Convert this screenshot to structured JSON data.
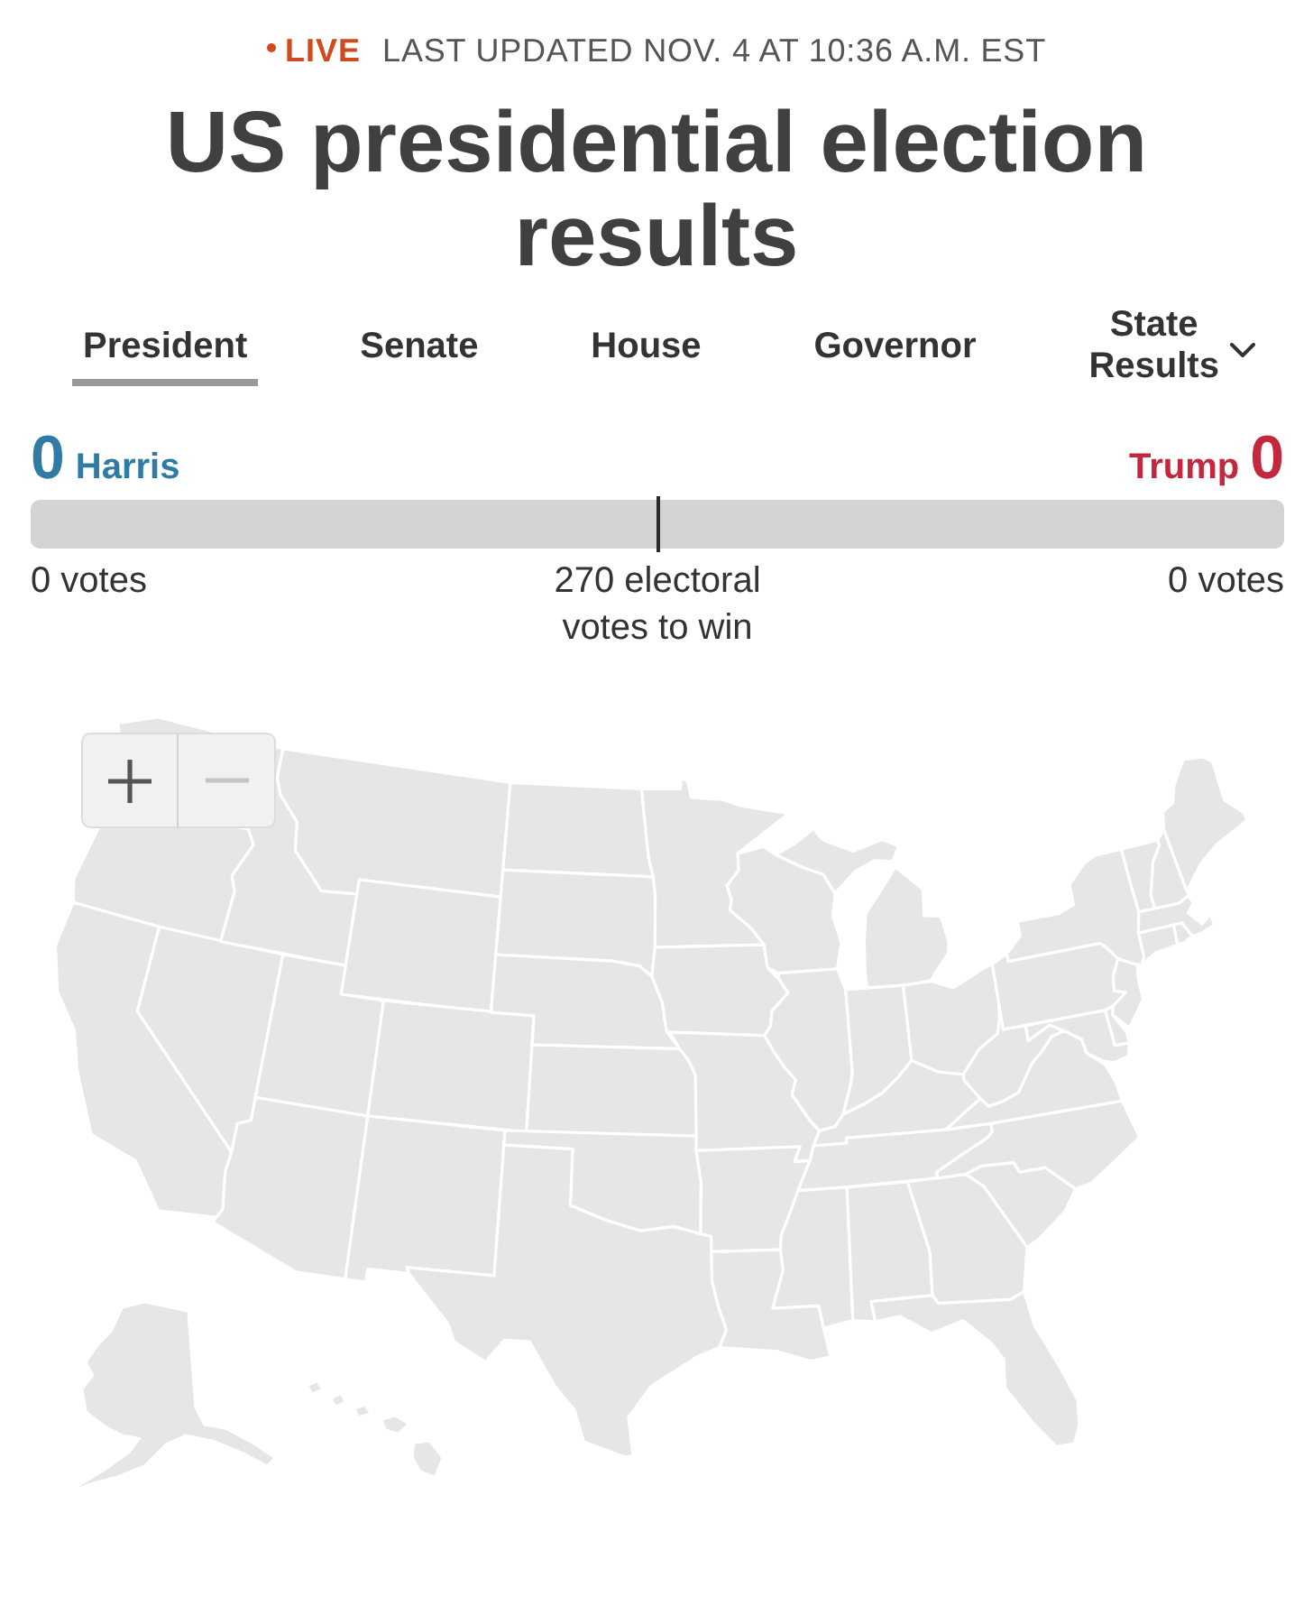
{
  "status": {
    "label": "LIVE",
    "last_updated": "LAST UPDATED NOV. 4 AT 10:36 A.M. EST"
  },
  "title": "US presidential election results",
  "tabs": [
    {
      "label": "President",
      "selected": true,
      "kind": "tab"
    },
    {
      "label": "Senate",
      "selected": false,
      "kind": "tab"
    },
    {
      "label": "House",
      "selected": false,
      "kind": "tab"
    },
    {
      "label": "Governor",
      "selected": false,
      "kind": "tab"
    },
    {
      "label": "State Results",
      "selected": false,
      "kind": "dropdown"
    }
  ],
  "race": {
    "candidates": [
      {
        "name": "Harris",
        "electoral_votes": "0",
        "votes": "0 votes",
        "color": "#2f7ba5"
      },
      {
        "name": "Trump",
        "electoral_votes": "0",
        "votes": "0 votes",
        "color": "#c4283f"
      }
    ],
    "threshold": "270 electoral votes to win"
  },
  "map": {
    "zoom_in": {
      "disabled": false
    },
    "zoom_out": {
      "disabled": true
    }
  }
}
